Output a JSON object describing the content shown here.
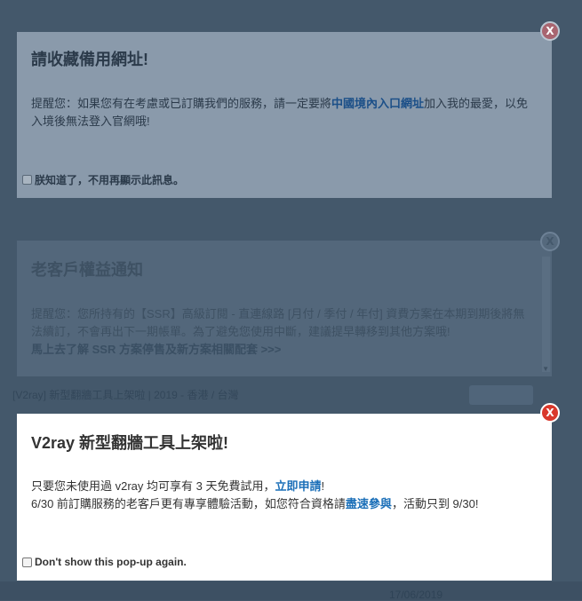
{
  "background": {
    "row_text": "[V2ray] 新型翻牆工具上架啦 | 2019 - 香港 / 台灣",
    "date": "17/06/2019"
  },
  "popup1": {
    "title": "請收藏備用網址!",
    "text_before": "提醒您：如果您有在考慮或已訂購我們的服務，請一定要將",
    "link": "中國境內入口網址",
    "text_after": "加入我的最愛，以免入境後無法登入官網哦!",
    "checkbox_label": "朕知道了，不用再顯示此訊息。"
  },
  "popup2": {
    "title": "老客戶權益通知",
    "text": "提醒您：您所持有的【SSR】高級訂閱 - 直連線路 [月付 / 季付 / 年付] 資費方案在本期到期後將無法續訂，不會再出下一期帳單。為了避免您使用中斷，建議提早轉移到其他方案哦!",
    "link": "馬上去了解 SSR 方案停售及新方案相關配套 >>>"
  },
  "popup3": {
    "title": "V2ray 新型翻牆工具上架啦!",
    "line1_before": "只要您未使用過 v2ray 均可享有 3 天免費試用，",
    "line1_link": "立即申請",
    "line1_after": "!",
    "line2_before": "6/30 前訂購服務的老客戶更有專享體驗活動，如您符合資格請",
    "line2_link": "盡速參與",
    "line2_after": "，活動只到 9/30!",
    "checkbox_label": "Don't show this pop-up again."
  },
  "close_glyph": "X"
}
